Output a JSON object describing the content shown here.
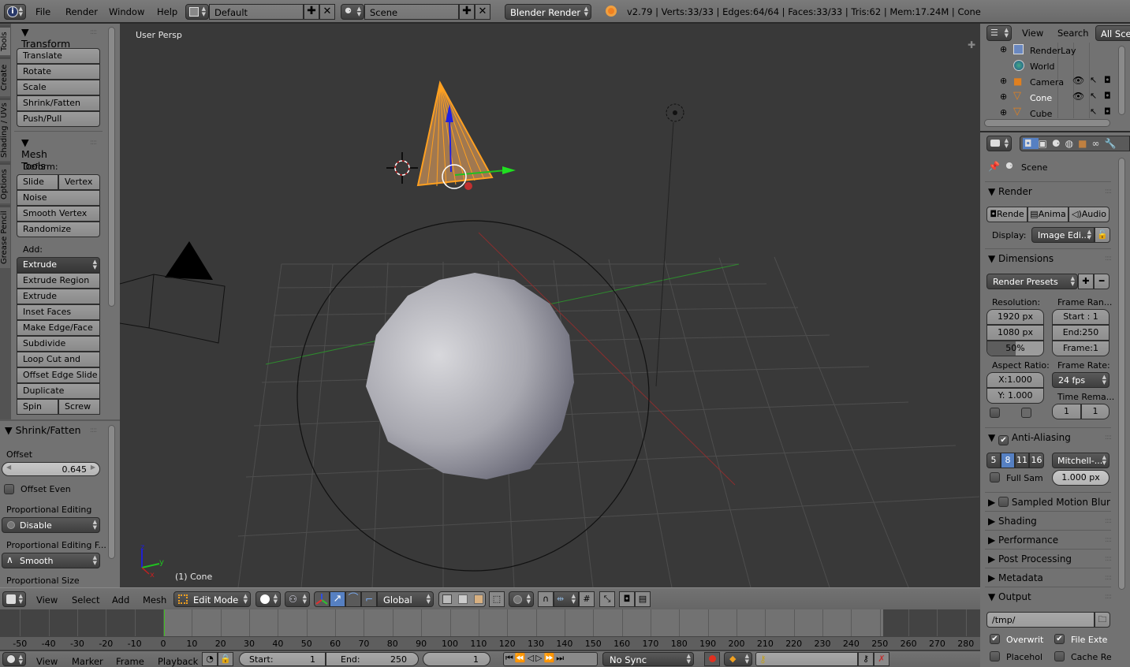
{
  "topbar": {
    "menus": [
      "File",
      "Render",
      "Window",
      "Help"
    ],
    "screen_layout": "Default",
    "scene": "Scene",
    "render_engine": "Blender Render",
    "stats": "v2.79 | Verts:33/33 | Edges:64/64 | Faces:33/33 | Tris:62 | Mem:17.24M | Cone"
  },
  "tool_tabs": [
    "Tools",
    "Create",
    "Shading / UVs",
    "Options",
    "Grease Pencil"
  ],
  "toolshelf": {
    "transform": {
      "title": "Transform",
      "buttons": [
        "Translate",
        "Rotate",
        "Scale",
        "Shrink/Fatten",
        "Push/Pull"
      ]
    },
    "mesh_tools": {
      "title": "Mesh Tools",
      "deform_label": "Deform:",
      "deform_pair": [
        "Slide Ed",
        "Vertex"
      ],
      "deform_buttons": [
        "Noise",
        "Smooth Vertex",
        "Randomize"
      ],
      "add_label": "Add:",
      "extrude_menu": "Extrude",
      "add_buttons": [
        "Extrude Region",
        "Extrude Individual",
        "Inset Faces",
        "Make Edge/Face",
        "Subdivide",
        "Loop Cut and Slide",
        "Offset Edge Slide",
        "Duplicate"
      ],
      "spin_pair": [
        "Spin",
        "Screw"
      ]
    }
  },
  "last_operator": {
    "title": "Shrink/Fatten",
    "offset_label": "Offset",
    "offset_value": "0.645",
    "offset_even_label": "Offset Even",
    "offset_even_checked": false,
    "prop_edit_label": "Proportional Editing",
    "prop_edit_value": "Disable",
    "prop_falloff_label": "Proportional Editing F...",
    "prop_falloff_value": "Smooth",
    "prop_size_label": "Proportional Size"
  },
  "viewport": {
    "view_name": "User Persp",
    "object_label": "(1) Cone",
    "axis_labels": {
      "x": "x",
      "y": "y",
      "z": "z"
    }
  },
  "view3d_header": {
    "menus": [
      "View",
      "Select",
      "Add",
      "Mesh"
    ],
    "mode": "Edit Mode",
    "orientation": "Global"
  },
  "timeline": {
    "ticks": [
      "-50",
      "-40",
      "-30",
      "-20",
      "-10",
      "0",
      "10",
      "20",
      "30",
      "40",
      "50",
      "60",
      "70",
      "80",
      "90",
      "100",
      "110",
      "120",
      "130",
      "140",
      "150",
      "160",
      "170",
      "180",
      "190",
      "200",
      "210",
      "220",
      "230",
      "240",
      "250",
      "260",
      "270",
      "280"
    ],
    "current_frame_marker": 0,
    "menus": [
      "View",
      "Marker",
      "Frame",
      "Playback"
    ],
    "start_label": "Start:",
    "start_value": "1",
    "end_label": "End:",
    "end_value": "250",
    "current_frame": "1",
    "sync": "No Sync"
  },
  "outliner": {
    "menus": [
      "View",
      "Search"
    ],
    "display_mode": "All Sce",
    "items": [
      {
        "name": "RenderLay",
        "type": "renderlayer"
      },
      {
        "name": "World",
        "type": "world"
      },
      {
        "name": "Camera",
        "type": "camera"
      },
      {
        "name": "Cone",
        "type": "mesh",
        "selected": true
      },
      {
        "name": "Cube",
        "type": "mesh"
      }
    ]
  },
  "properties": {
    "context": "Scene",
    "render": {
      "title": "Render",
      "buttons": [
        "Rende",
        "Anima",
        "Audio"
      ],
      "display_label": "Display:",
      "display_value": "Image Edi..."
    },
    "dimensions": {
      "title": "Dimensions",
      "presets": "Render Presets",
      "resolution_label": "Resolution:",
      "res_x": "1920 px",
      "res_y": "1080 px",
      "res_pct": "50%",
      "res_pct_fraction": 0.5,
      "frame_range_label": "Frame Ran...",
      "start": "Start : 1",
      "end": "End:250",
      "frame": "Frame:1",
      "aspect_label": "Aspect Ratio:",
      "aspect_x": "X:1.000",
      "aspect_y": "Y: 1.000",
      "frame_rate_label": "Frame Rate:",
      "frame_rate": "24 fps",
      "time_remap_label": "Time Rema...",
      "time_old": "1",
      "time_new": "1"
    },
    "anti_aliasing": {
      "title": "Anti-Aliasing",
      "enabled": true,
      "samples": [
        "5",
        "8",
        "11",
        "16"
      ],
      "selected_sample": "8",
      "filter": "Mitchell-...",
      "full_sample_label": "Full Sam",
      "filter_size": "1.000 px"
    },
    "collapsed_sections": [
      "Sampled Motion Blur",
      "Shading",
      "Performance",
      "Post Processing",
      "Metadata"
    ],
    "output": {
      "title": "Output",
      "path": "/tmp/",
      "overwrite_label": "Overwrit",
      "overwrite": true,
      "file_ext_label": "File Exte",
      "file_ext": true,
      "placeholder_label": "Placehol",
      "placeholder": false,
      "cache_label": "Cache Re",
      "cache": false
    }
  },
  "colors": {
    "selection_orange": "#ffa020",
    "x_axis": "#c03030",
    "y_axis": "#30c030",
    "z_axis": "#3030e0",
    "active_blue": "#5680c2",
    "playhead_green": "#40c020"
  }
}
